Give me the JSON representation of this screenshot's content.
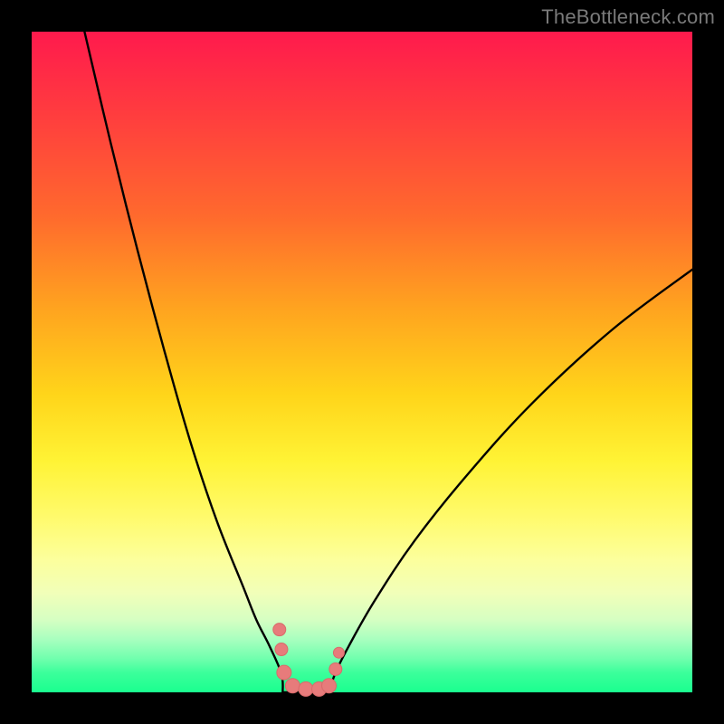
{
  "watermark": "TheBottleneck.com",
  "palette": {
    "background": "#000000",
    "curve_color": "#000000",
    "marker_fill": "#e77b7b",
    "marker_stroke": "#d86a6a"
  },
  "chart_data": {
    "type": "line",
    "title": "",
    "xlabel": "",
    "ylabel": "",
    "xlim": [
      0,
      100
    ],
    "ylim": [
      0,
      100
    ],
    "grid": false,
    "legend": false,
    "series": [
      {
        "name": "left_curve",
        "x": [
          8,
          12,
          16,
          20,
          24,
          28,
          32,
          34,
          36,
          37.8,
          38
        ],
        "y": [
          100,
          83,
          67,
          52,
          38,
          26,
          16,
          11,
          7,
          2.8,
          0
        ]
      },
      {
        "name": "right_curve",
        "x": [
          45,
          46,
          48,
          52,
          58,
          66,
          76,
          88,
          100
        ],
        "y": [
          0,
          3,
          7,
          14,
          23,
          33,
          44,
          55,
          64
        ]
      }
    ],
    "floor_segment": {
      "x": [
        38,
        45
      ],
      "y": [
        0,
        0
      ]
    },
    "markers": [
      {
        "x": 37.5,
        "y": 9.5,
        "r": 7
      },
      {
        "x": 37.8,
        "y": 6.5,
        "r": 7
      },
      {
        "x": 38.2,
        "y": 3.0,
        "r": 8
      },
      {
        "x": 39.5,
        "y": 1.0,
        "r": 8
      },
      {
        "x": 41.5,
        "y": 0.5,
        "r": 8
      },
      {
        "x": 43.5,
        "y": 0.5,
        "r": 8
      },
      {
        "x": 45.0,
        "y": 1.0,
        "r": 8
      },
      {
        "x": 46.0,
        "y": 3.5,
        "r": 7
      },
      {
        "x": 46.5,
        "y": 6.0,
        "r": 6
      }
    ]
  }
}
